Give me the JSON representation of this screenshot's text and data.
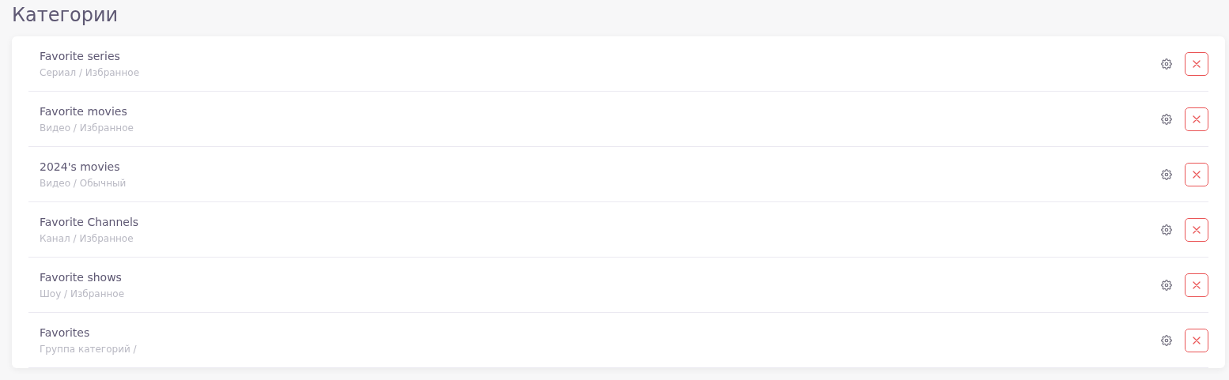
{
  "page_title": "Категории",
  "categories": [
    {
      "name": "Favorite series",
      "subtitle": "Сериал / Избранное"
    },
    {
      "name": "Favorite movies",
      "subtitle": "Видео / Избранное"
    },
    {
      "name": "2024's movies",
      "subtitle": "Видео / Обычный"
    },
    {
      "name": "Favorite Channels",
      "subtitle": "Канал / Избранное"
    },
    {
      "name": "Favorite shows",
      "subtitle": "Шоу / Избранное"
    },
    {
      "name": "Favorites",
      "subtitle": "Группа категорий /"
    }
  ]
}
